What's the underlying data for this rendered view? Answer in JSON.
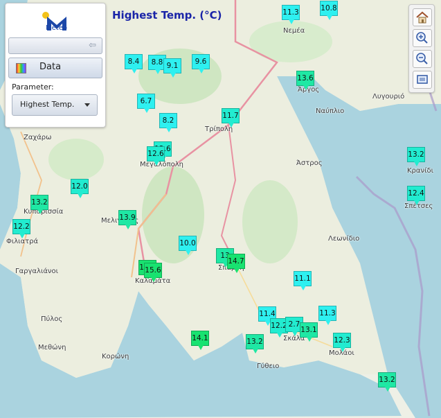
{
  "title": "Highest Temp. (°C)",
  "panel": {
    "logo_text": "Meteo",
    "data_button_label": "Data",
    "parameter_label": "Parameter:",
    "parameter_value": "Highest Temp."
  },
  "toolbar": {
    "home": "home-icon",
    "zoom_in": "zoom-in-icon",
    "zoom_out": "zoom-out-icon",
    "fit": "fit-extent-icon"
  },
  "places": [
    "Νεμέα",
    "Άργος",
    "Ναύπλιο",
    "Λυγουριό",
    "Τρίπολη",
    "Ζαχάρω",
    "Μεγαλόπολη",
    "Άστρος",
    "Κρανίδι",
    "Σπέτσες",
    "Κυπαρισσία",
    "Φιλιατρά",
    "Μελιγαλάς",
    "Λεωνίδιο",
    "Σπάρτη",
    "Γαργαλιάνοι",
    "Καλαμάτα",
    "Πύλος",
    "Σκάλα",
    "Μολάοι",
    "Μεθώνη",
    "Κορώνη",
    "Γύθειο"
  ],
  "stations": [
    "11.3",
    "10.8",
    "8.4",
    "8.8",
    "9.1",
    "9.6",
    "13.6",
    "6.7",
    "8.2",
    "11.7",
    "12.6",
    "2",
    "12.6",
    "12.0",
    "13.2",
    "12.4",
    "12.2",
    "13.9",
    "10.0",
    "13",
    "14.7",
    "15.6",
    "11.1",
    "11.4",
    "12.2",
    "2.7",
    "13.1",
    "11.3",
    "14.1",
    "13.2",
    "12.3",
    "13.2"
  ],
  "colors": {
    "cyan": "#2ef0f0",
    "aqua": "#22ecd0",
    "mint": "#1fe8a4",
    "green": "#18e270"
  }
}
